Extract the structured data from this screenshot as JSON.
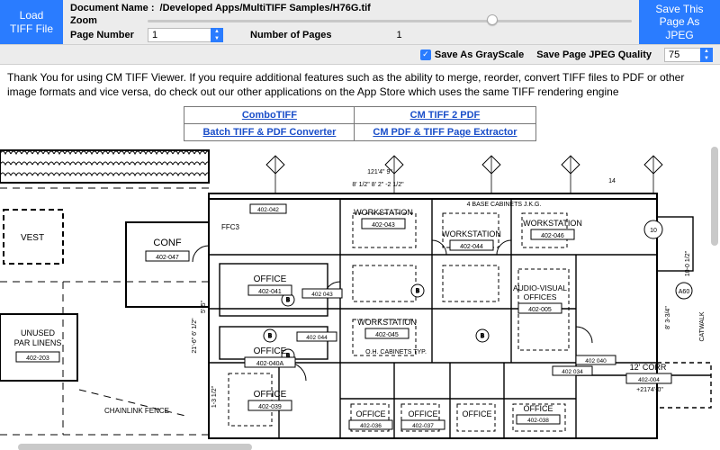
{
  "toolbar": {
    "load_label": "Load TIFF File",
    "save_label": "Save This Page As JPEG",
    "docname_label": "Document Name :",
    "docname_value": "/Developed Apps/MultiTIFF Samples/H76G.tif",
    "zoom_label": "Zoom",
    "zoom_percent": 70,
    "page_number_label": "Page Number",
    "page_number_value": "1",
    "num_pages_label": "Number of Pages",
    "num_pages_value": "1"
  },
  "options": {
    "grayscale_label": "Save As GrayScale",
    "grayscale_checked": true,
    "quality_label": "Save Page JPEG Quality",
    "quality_value": "75"
  },
  "promo": {
    "text": "Thank You for using CM TIFF Viewer. If you require additional features such as the ability to merge, reorder, convert TIFF files to PDF or other image formats and vice versa, do check out our other applications on the App Store which uses the same TIFF rendering engine",
    "links": [
      [
        "ComboTIFF",
        "CM TIFF 2 PDF"
      ],
      [
        "Batch TIFF & PDF Converter",
        "CM PDF & TIFF Page Extractor"
      ]
    ]
  },
  "plan": {
    "rooms": {
      "conf": {
        "name": "CONF",
        "code": "402-047"
      },
      "unused": {
        "name": "UNUSED\nPAR LINENS",
        "code": "402-203"
      },
      "ws1": {
        "name": "WORKSTATION",
        "code": "402-043"
      },
      "ws2": {
        "name": "WORKSTATION",
        "code": "402-044"
      },
      "ws3": {
        "name": "WORKSTATION",
        "code": "402-046"
      },
      "ws4": {
        "name": "WORKSTATION",
        "code": "402-045"
      },
      "av": {
        "name": "AUDIO-VISUAL\nOFFICES",
        "code": "402-005"
      },
      "off1": {
        "name": "OFFICE",
        "code": "402-041"
      },
      "off2": {
        "name": "OFFICE",
        "code": "402-040A"
      },
      "off3": {
        "name": "OFFICE",
        "code": "402-039"
      },
      "off4": {
        "name": "OFFICE",
        "code": "402-036"
      },
      "off5": {
        "name": "OFFICE",
        "code": "402-037"
      },
      "off6": {
        "name": "OFFICE",
        "code": "402-038"
      },
      "corr": {
        "name": "12' CORR",
        "code": "402-004"
      },
      "vest": {
        "name": "VEST"
      }
    },
    "notes": {
      "cabinets": "4 BASE CABINETS J.K.G.",
      "ohcab": "O.H. CABINETS TYP.",
      "chainlink": "CHAINLINK FENCE",
      "ffc3": "FFC3",
      "dims": {
        "d1": "121'4\" 9\"",
        "d2": "8' 1/2\"   8' 2\"  -2 1/2\"",
        "d3": "5'-5\"",
        "d4": "21'-6\"  6' 1/2\"",
        "d5": "1-3 1/2\"",
        "d6": "8' 3-3/4\"",
        "d7": "10-0 1/2\"",
        "d8": "+2174'-0\"",
        "d9": "14",
        "d10": "10"
      },
      "tags": {
        "t342": "402-042",
        "t043": "402 043",
        "t044": "402 044",
        "t034": "402 034",
        "t040": "402 040"
      }
    }
  }
}
